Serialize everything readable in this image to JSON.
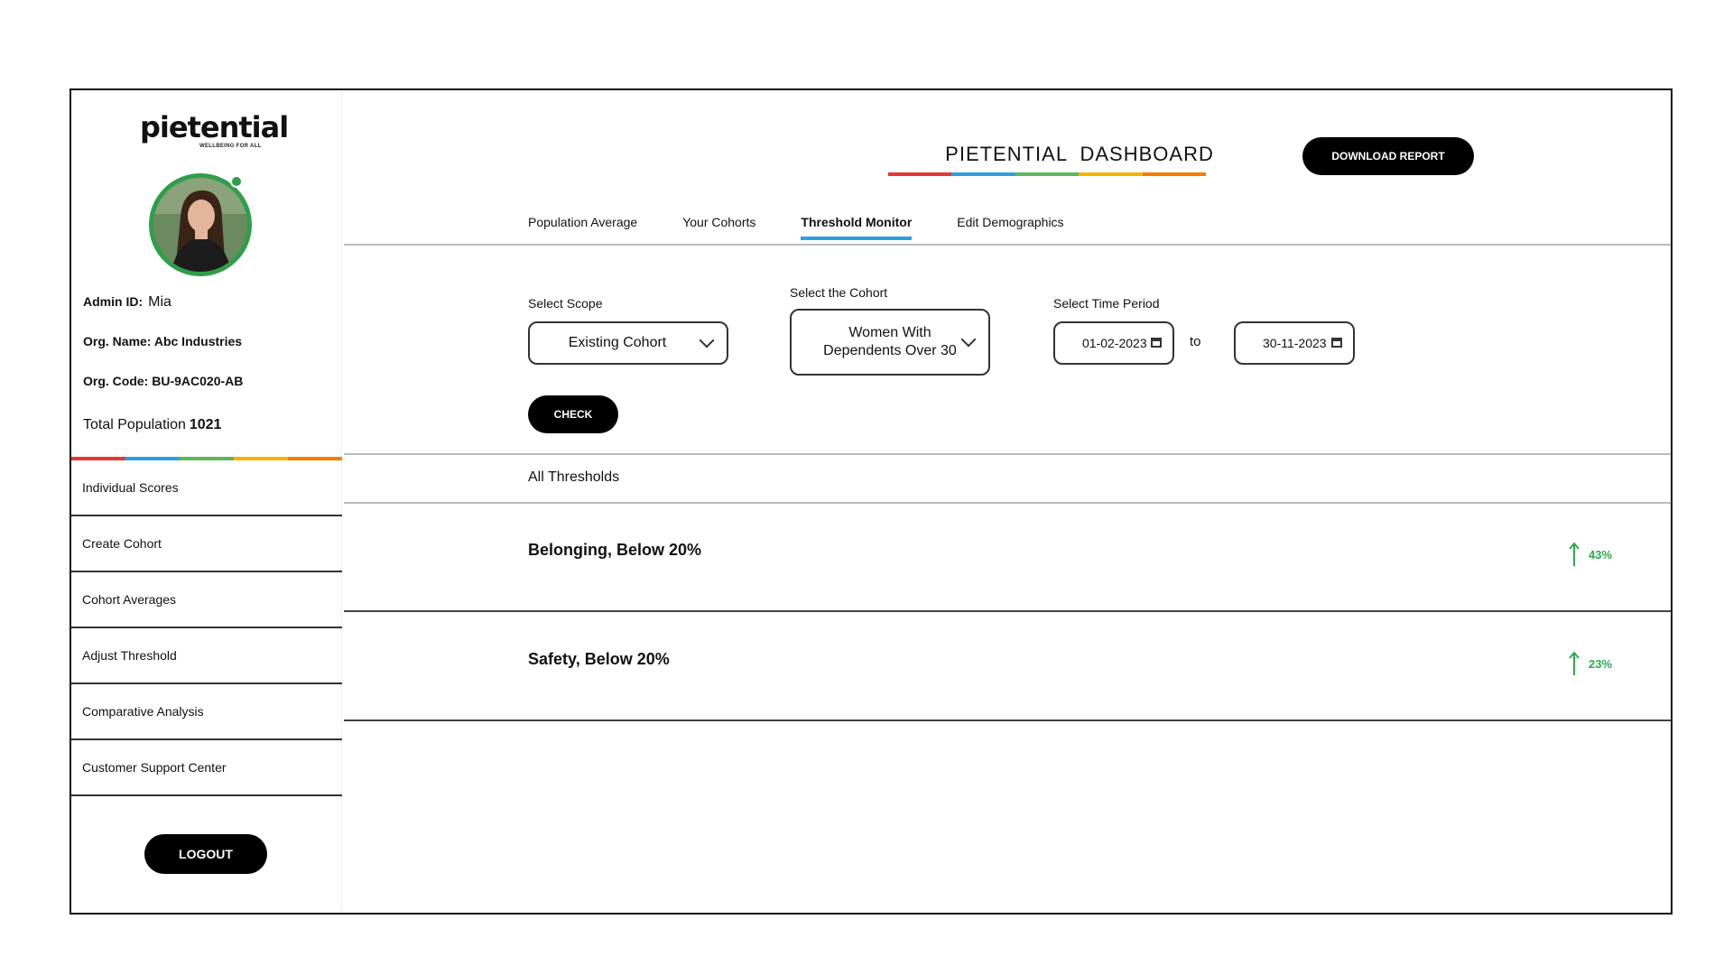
{
  "brand": {
    "logo_text": "pietential",
    "tagline": "WELLBEING FOR ALL",
    "rainbow": [
      "#e53935",
      "#2aa0e0",
      "#5cb85c",
      "#f4b400",
      "#f57c00"
    ],
    "accent_green": "#2fa84f"
  },
  "profile": {
    "admin_label": "Admin ID:",
    "admin_value": "Mia",
    "org_name_label": "Org. Name:",
    "org_name_value": "Abc Industries",
    "org_code_label": "Org. Code:",
    "org_code_value": "BU-9AC020-AB",
    "population_label": "Total Population",
    "population_value": "1021"
  },
  "sidebar": {
    "items": [
      {
        "label": "Individual Scores"
      },
      {
        "label": "Create Cohort"
      },
      {
        "label": "Cohort Averages"
      },
      {
        "label": "Adjust Threshold"
      },
      {
        "label": "Comparative Analysis"
      },
      {
        "label": "Customer Support Center"
      }
    ],
    "logout_label": "LOGOUT"
  },
  "header": {
    "title": "PIETENTIAL  DASHBOARD",
    "download_label": "DOWNLOAD REPORT"
  },
  "tabs": [
    {
      "label": "Population Average",
      "active": false
    },
    {
      "label": "Your Cohorts",
      "active": false
    },
    {
      "label": "Threshold Monitor",
      "active": true
    },
    {
      "label": "Edit Demographics",
      "active": false
    }
  ],
  "filters": {
    "scope_label": "Select Scope",
    "scope_value": "Existing Cohort",
    "cohort_label": "Select the Cohort",
    "cohort_value": "Women With Dependents Over 30",
    "period_label": "Select Time Period",
    "date_from": "01-02-2023",
    "to_text": "to",
    "date_to": "30-11-2023",
    "check_label": "CHECK"
  },
  "thresholds": {
    "heading": "All Thresholds",
    "rows": [
      {
        "label": "Belonging, Below 20%",
        "change": "43%",
        "direction": "up-arrow-icon"
      },
      {
        "label": "Safety, Below 20%",
        "change": "23%",
        "direction": "up-arrow-icon"
      }
    ]
  }
}
